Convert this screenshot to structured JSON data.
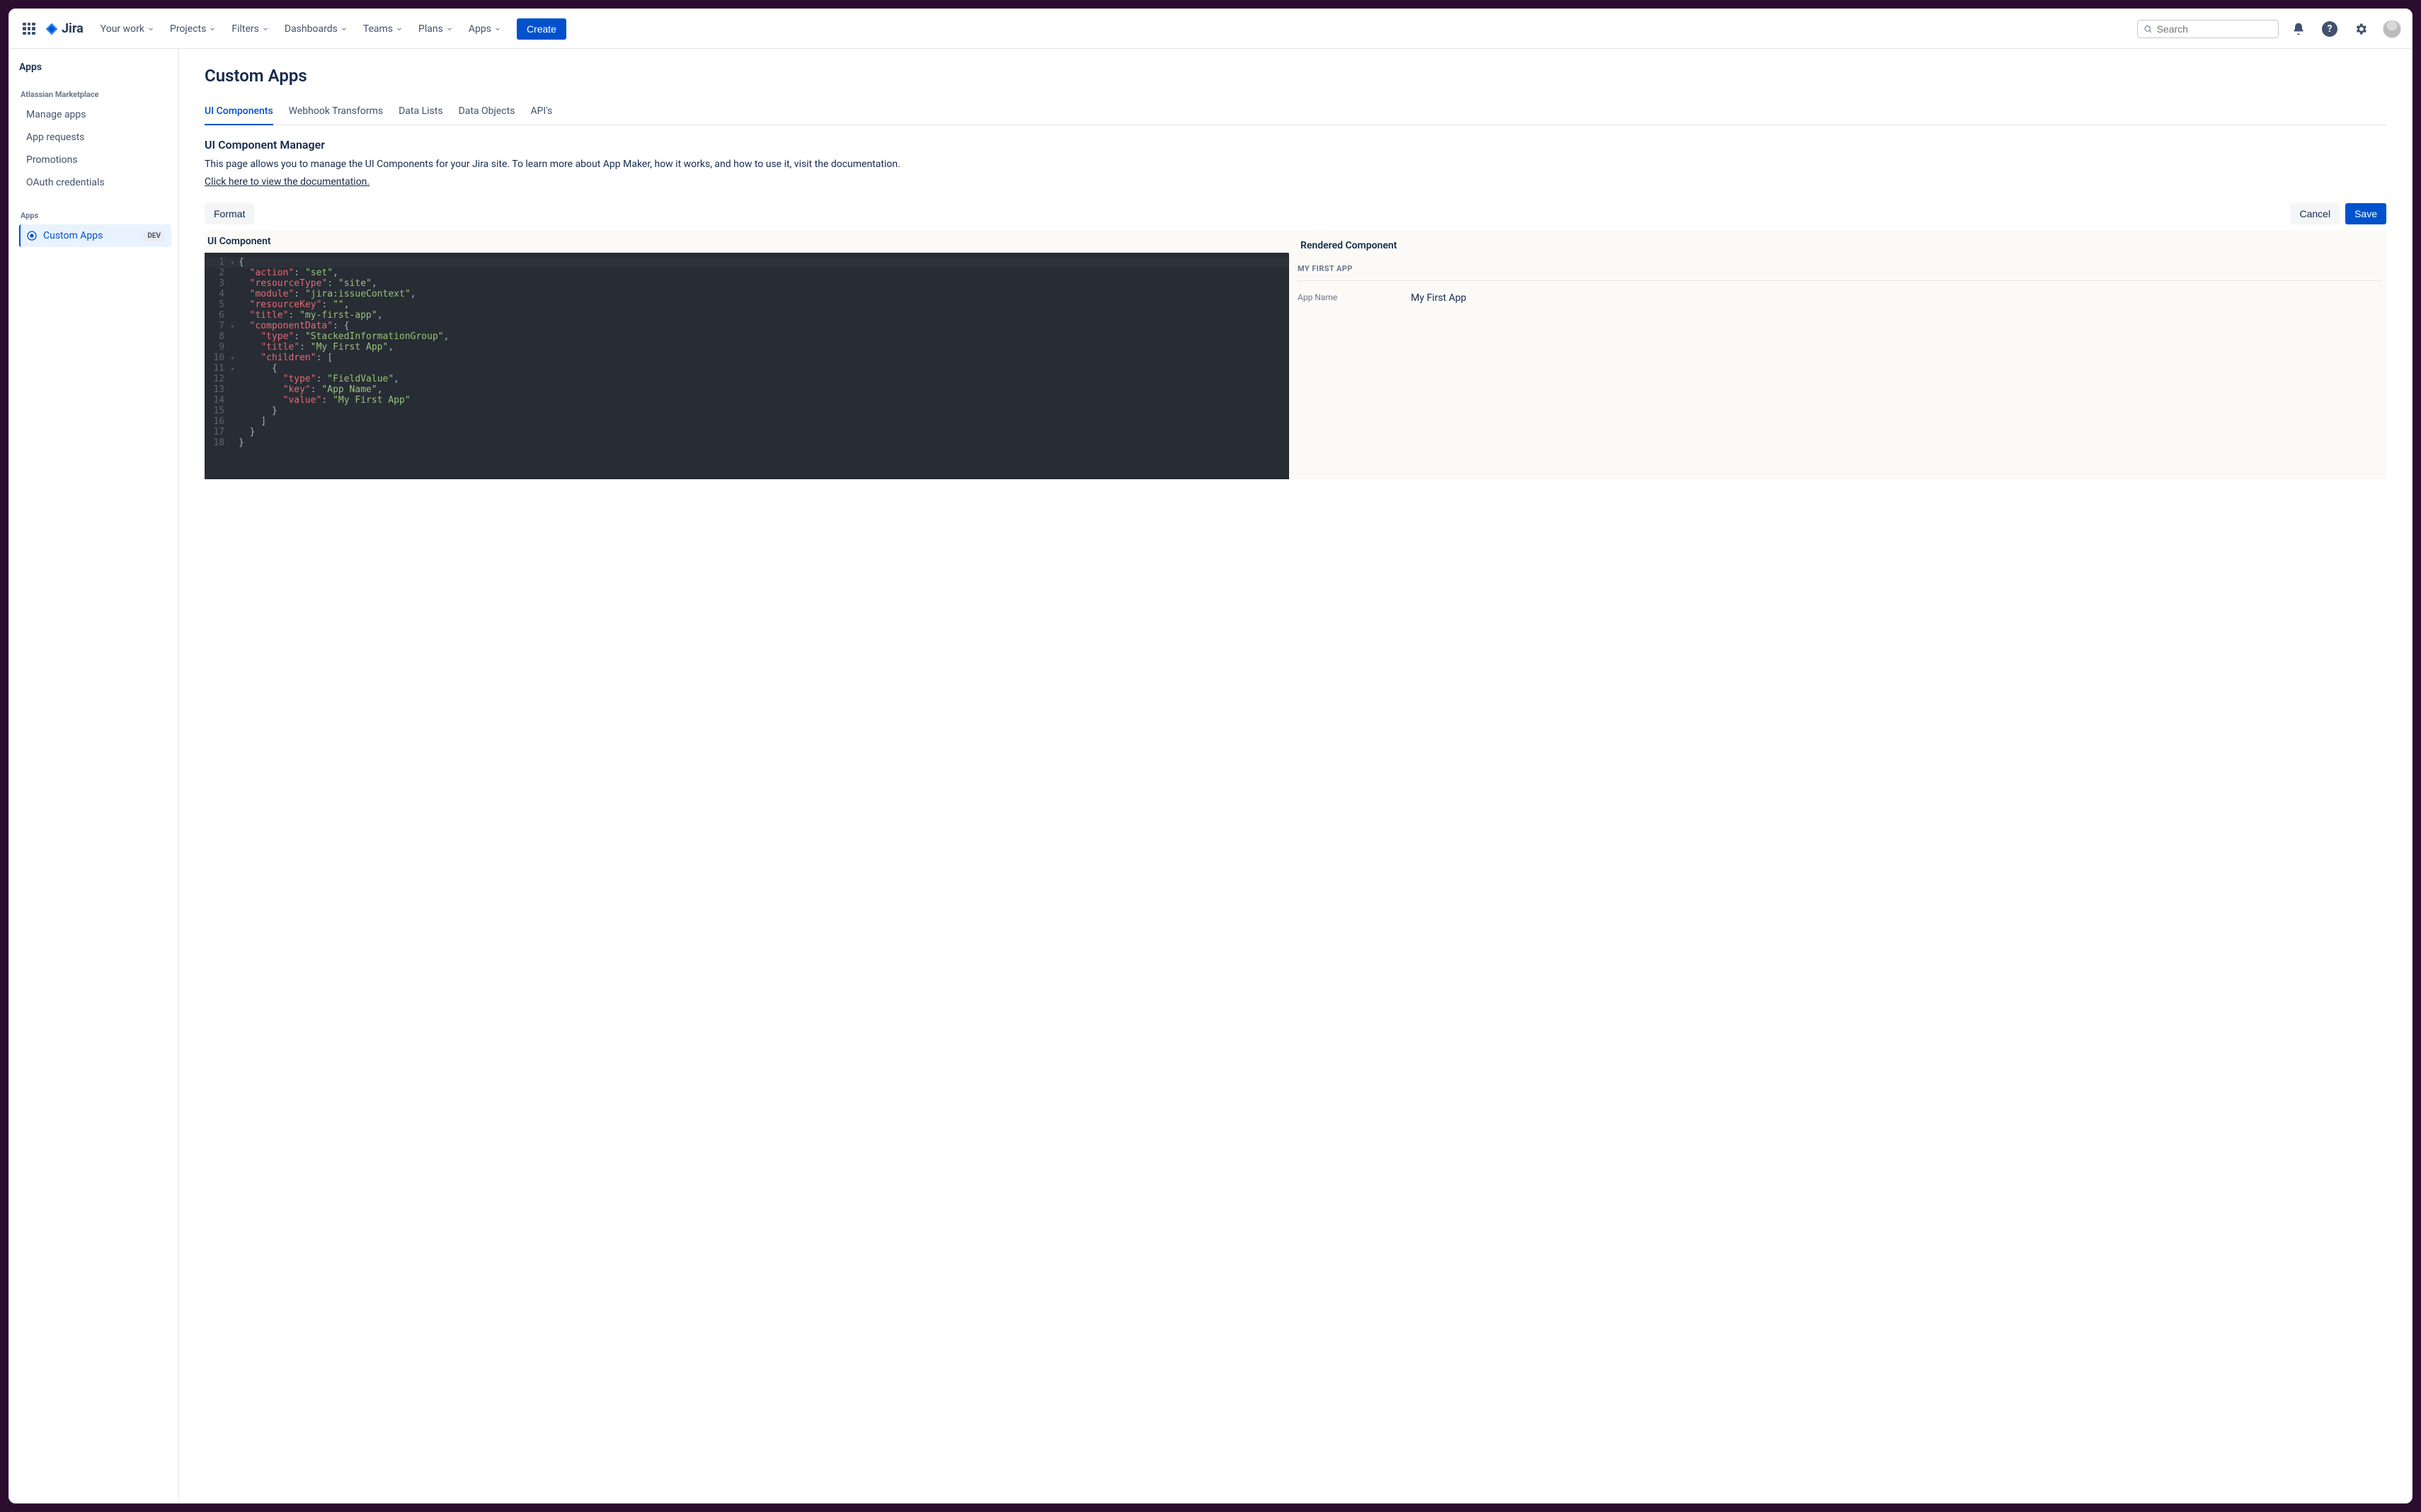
{
  "app": {
    "name": "Jira"
  },
  "search": {
    "placeholder": "Search"
  },
  "topnav": {
    "items": [
      "Your work",
      "Projects",
      "Filters",
      "Dashboards",
      "Teams",
      "Plans",
      "Apps"
    ],
    "create": "Create"
  },
  "sidebar": {
    "heading": "Apps",
    "groupMarketplace": "Atlassian Marketplace",
    "marketplaceItems": [
      "Manage apps",
      "App requests",
      "Promotions",
      "OAuth credentials"
    ],
    "groupApps": "Apps",
    "customApps": "Custom Apps",
    "devBadge": "DEV"
  },
  "page": {
    "title": "Custom Apps",
    "tabs": [
      "UI Components",
      "Webhook Transforms",
      "Data Lists",
      "Data Objects",
      "API's"
    ],
    "activeTab": 0,
    "sectionTitle": "UI Component Manager",
    "intro": "This page allows you to manage the UI Components for your Jira site. To learn more about App Maker, how it works, and how to use it, visit the documentation.",
    "docLink": "Click here to view the documentation."
  },
  "toolbar": {
    "format": "Format",
    "cancel": "Cancel",
    "save": "Save"
  },
  "editor": {
    "leftHeader": "UI Component",
    "rightHeader": "Rendered Component",
    "lines": [
      {
        "n": 1,
        "indent": 0,
        "fold": true,
        "tokens": [
          {
            "t": "{",
            "c": "p"
          }
        ]
      },
      {
        "n": 2,
        "indent": 1,
        "tokens": [
          {
            "t": "\"action\"",
            "c": "k"
          },
          {
            "t": ": ",
            "c": "p"
          },
          {
            "t": "\"set\"",
            "c": "s"
          },
          {
            "t": ",",
            "c": "p"
          }
        ]
      },
      {
        "n": 3,
        "indent": 1,
        "tokens": [
          {
            "t": "\"resourceType\"",
            "c": "k"
          },
          {
            "t": ": ",
            "c": "p"
          },
          {
            "t": "\"site\"",
            "c": "s"
          },
          {
            "t": ",",
            "c": "p"
          }
        ]
      },
      {
        "n": 4,
        "indent": 1,
        "tokens": [
          {
            "t": "\"module\"",
            "c": "k"
          },
          {
            "t": ": ",
            "c": "p"
          },
          {
            "t": "\"jira:issueContext\"",
            "c": "s"
          },
          {
            "t": ",",
            "c": "p"
          }
        ]
      },
      {
        "n": 5,
        "indent": 1,
        "tokens": [
          {
            "t": "\"resourceKey\"",
            "c": "k"
          },
          {
            "t": ": ",
            "c": "p"
          },
          {
            "t": "\"\"",
            "c": "s"
          },
          {
            "t": ",",
            "c": "p"
          }
        ]
      },
      {
        "n": 6,
        "indent": 1,
        "tokens": [
          {
            "t": "\"title\"",
            "c": "k"
          },
          {
            "t": ": ",
            "c": "p"
          },
          {
            "t": "\"my-first-app\"",
            "c": "s"
          },
          {
            "t": ",",
            "c": "p"
          }
        ]
      },
      {
        "n": 7,
        "indent": 1,
        "fold": true,
        "tokens": [
          {
            "t": "\"componentData\"",
            "c": "k"
          },
          {
            "t": ": {",
            "c": "p"
          }
        ]
      },
      {
        "n": 8,
        "indent": 2,
        "tokens": [
          {
            "t": "\"type\"",
            "c": "k"
          },
          {
            "t": ": ",
            "c": "p"
          },
          {
            "t": "\"StackedInformationGroup\"",
            "c": "s"
          },
          {
            "t": ",",
            "c": "p"
          }
        ]
      },
      {
        "n": 9,
        "indent": 2,
        "tokens": [
          {
            "t": "\"title\"",
            "c": "k"
          },
          {
            "t": ": ",
            "c": "p"
          },
          {
            "t": "\"My First App\"",
            "c": "s"
          },
          {
            "t": ",",
            "c": "p"
          }
        ]
      },
      {
        "n": 10,
        "indent": 2,
        "fold": true,
        "tokens": [
          {
            "t": "\"children\"",
            "c": "k"
          },
          {
            "t": ": [",
            "c": "p"
          }
        ]
      },
      {
        "n": 11,
        "indent": 3,
        "fold": true,
        "tokens": [
          {
            "t": "{",
            "c": "p"
          }
        ]
      },
      {
        "n": 12,
        "indent": 4,
        "tokens": [
          {
            "t": "\"type\"",
            "c": "k"
          },
          {
            "t": ": ",
            "c": "p"
          },
          {
            "t": "\"FieldValue\"",
            "c": "s"
          },
          {
            "t": ",",
            "c": "p"
          }
        ]
      },
      {
        "n": 13,
        "indent": 4,
        "tokens": [
          {
            "t": "\"key\"",
            "c": "k"
          },
          {
            "t": ": ",
            "c": "p"
          },
          {
            "t": "\"App Name\"",
            "c": "s"
          },
          {
            "t": ",",
            "c": "p"
          }
        ]
      },
      {
        "n": 14,
        "indent": 4,
        "tokens": [
          {
            "t": "\"value\"",
            "c": "k"
          },
          {
            "t": ": ",
            "c": "p"
          },
          {
            "t": "\"My First App\"",
            "c": "s"
          }
        ]
      },
      {
        "n": 15,
        "indent": 3,
        "tokens": [
          {
            "t": "}",
            "c": "p"
          }
        ]
      },
      {
        "n": 16,
        "indent": 2,
        "tokens": [
          {
            "t": "]",
            "c": "p"
          }
        ]
      },
      {
        "n": 17,
        "indent": 1,
        "tokens": [
          {
            "t": "}",
            "c": "p"
          }
        ]
      },
      {
        "n": 18,
        "indent": 0,
        "tokens": [
          {
            "t": "}",
            "c": "p"
          }
        ]
      }
    ]
  },
  "rendered": {
    "groupTitle": "MY FIRST APP",
    "fields": [
      {
        "label": "App Name",
        "value": "My First App"
      }
    ]
  }
}
